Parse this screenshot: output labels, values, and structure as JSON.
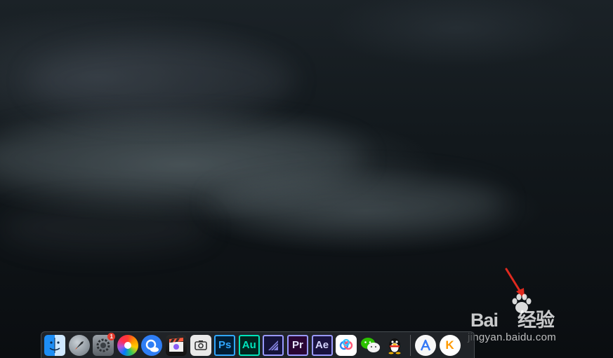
{
  "dock": {
    "items": [
      {
        "name": "finder-icon",
        "label": ""
      },
      {
        "name": "launchpad-icon",
        "label": ""
      },
      {
        "name": "system-preferences-icon",
        "label": "",
        "badge": "1"
      },
      {
        "name": "color-wheel-app-icon",
        "label": ""
      },
      {
        "name": "browser-search-icon",
        "label": ""
      },
      {
        "name": "final-cut-pro-icon",
        "label": ""
      },
      {
        "name": "screenshot-app-icon",
        "label": ""
      },
      {
        "name": "photoshop-icon",
        "label": "Ps",
        "color": "#31a8ff"
      },
      {
        "name": "audition-icon",
        "label": "Au",
        "color": "#00e4bb"
      },
      {
        "name": "media-encoder-icon",
        "label": "",
        "color": "#9999ff"
      },
      {
        "name": "premiere-pro-icon",
        "label": "Pr",
        "color": "#9999ff"
      },
      {
        "name": "after-effects-icon",
        "label": "Ae",
        "color": "#9999ff"
      },
      {
        "name": "baidu-netdisk-icon",
        "label": ""
      },
      {
        "name": "wechat-icon",
        "label": ""
      },
      {
        "name": "qq-icon",
        "label": ""
      },
      {
        "name": "arc-app-icon",
        "label": ""
      },
      {
        "name": "kuwo-music-icon",
        "label": "K"
      }
    ]
  },
  "watermark": {
    "brand": "Bai",
    "brand_suffix": "经验",
    "url": "jingyan.baidu.com"
  },
  "colors": {
    "annotation_arrow": "#e02a1f"
  }
}
